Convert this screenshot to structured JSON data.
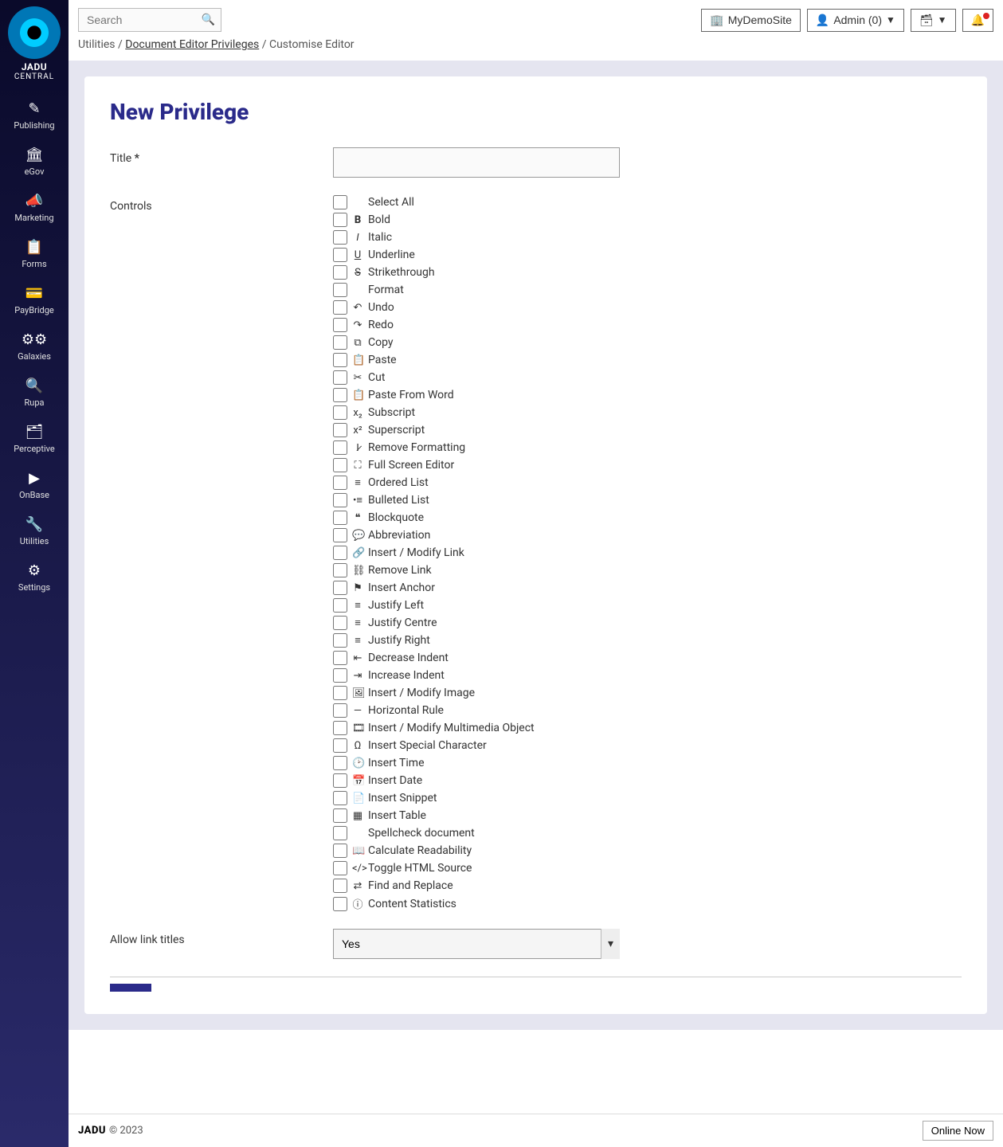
{
  "brand": {
    "top": "JADU",
    "bottom": "CENTRAL"
  },
  "sidebar": {
    "items": [
      {
        "icon": "✎",
        "label": "Publishing"
      },
      {
        "icon": "🏛",
        "label": "eGov"
      },
      {
        "icon": "📣",
        "label": "Marketing"
      },
      {
        "icon": "📋",
        "label": "Forms"
      },
      {
        "icon": "💳",
        "label": "PayBridge"
      },
      {
        "icon": "⚙⚙",
        "label": "Galaxies"
      },
      {
        "icon": "🔍",
        "label": "Rupa"
      },
      {
        "icon": "🗂",
        "label": "Perceptive"
      },
      {
        "icon": "▶",
        "label": "OnBase"
      },
      {
        "icon": "🔧",
        "label": "Utilities"
      },
      {
        "icon": "⚙",
        "label": "Settings"
      }
    ]
  },
  "topbar": {
    "search_placeholder": "Search",
    "site_button": "MyDemoSite",
    "admin_button": "Admin (0)"
  },
  "breadcrumbs": {
    "root": "Utilities",
    "link": "Document Editor Privileges",
    "current": "Customise Editor"
  },
  "page": {
    "title": "New Privilege",
    "title_label": "Title",
    "controls_label": "Controls",
    "allow_link_titles_label": "Allow link titles",
    "allow_link_titles_value": "Yes"
  },
  "controls": [
    {
      "icon": "",
      "label": "Select All"
    },
    {
      "icon": "B",
      "label": "Bold",
      "bold": true
    },
    {
      "icon": "I",
      "label": "Italic",
      "italic": true
    },
    {
      "icon": "U",
      "label": "Underline",
      "underline": true
    },
    {
      "icon": "S",
      "label": "Strikethrough",
      "strike": true
    },
    {
      "icon": "",
      "label": "Format"
    },
    {
      "icon": "↶",
      "label": "Undo"
    },
    {
      "icon": "↷",
      "label": "Redo"
    },
    {
      "icon": "⧉",
      "label": "Copy"
    },
    {
      "icon": "📋",
      "label": "Paste"
    },
    {
      "icon": "✂",
      "label": "Cut"
    },
    {
      "icon": "📋",
      "label": "Paste From Word"
    },
    {
      "icon": "x₂",
      "label": "Subscript"
    },
    {
      "icon": "x²",
      "label": "Superscript"
    },
    {
      "icon": "I̷",
      "label": "Remove Formatting"
    },
    {
      "icon": "⛶",
      "label": "Full Screen Editor"
    },
    {
      "icon": "≡",
      "label": "Ordered List"
    },
    {
      "icon": "•≡",
      "label": "Bulleted List"
    },
    {
      "icon": "❝",
      "label": "Blockquote"
    },
    {
      "icon": "💬",
      "label": "Abbreviation"
    },
    {
      "icon": "🔗",
      "label": "Insert / Modify Link"
    },
    {
      "icon": "⛓",
      "label": "Remove Link"
    },
    {
      "icon": "⚑",
      "label": "Insert Anchor"
    },
    {
      "icon": "≡",
      "label": "Justify Left"
    },
    {
      "icon": "≡",
      "label": "Justify Centre"
    },
    {
      "icon": "≡",
      "label": "Justify Right"
    },
    {
      "icon": "⇤",
      "label": "Decrease Indent"
    },
    {
      "icon": "⇥",
      "label": "Increase Indent"
    },
    {
      "icon": "🖼",
      "label": "Insert / Modify Image"
    },
    {
      "icon": "—",
      "label": "Horizontal Rule"
    },
    {
      "icon": "🎞",
      "label": "Insert / Modify Multimedia Object"
    },
    {
      "icon": "Ω",
      "label": "Insert Special Character"
    },
    {
      "icon": "🕑",
      "label": "Insert Time"
    },
    {
      "icon": "📅",
      "label": "Insert Date"
    },
    {
      "icon": "📄",
      "label": "Insert Snippet"
    },
    {
      "icon": "▦",
      "label": "Insert Table"
    },
    {
      "icon": "",
      "label": "Spellcheck document"
    },
    {
      "icon": "📖",
      "label": "Calculate Readability"
    },
    {
      "icon": "</>",
      "label": "Toggle HTML Source"
    },
    {
      "icon": "⇄",
      "label": "Find and Replace"
    },
    {
      "icon": "ⓘ",
      "label": "Content Statistics"
    }
  ],
  "footer": {
    "brand": "JADU",
    "copyright": "© 2023",
    "online": "Online Now"
  }
}
